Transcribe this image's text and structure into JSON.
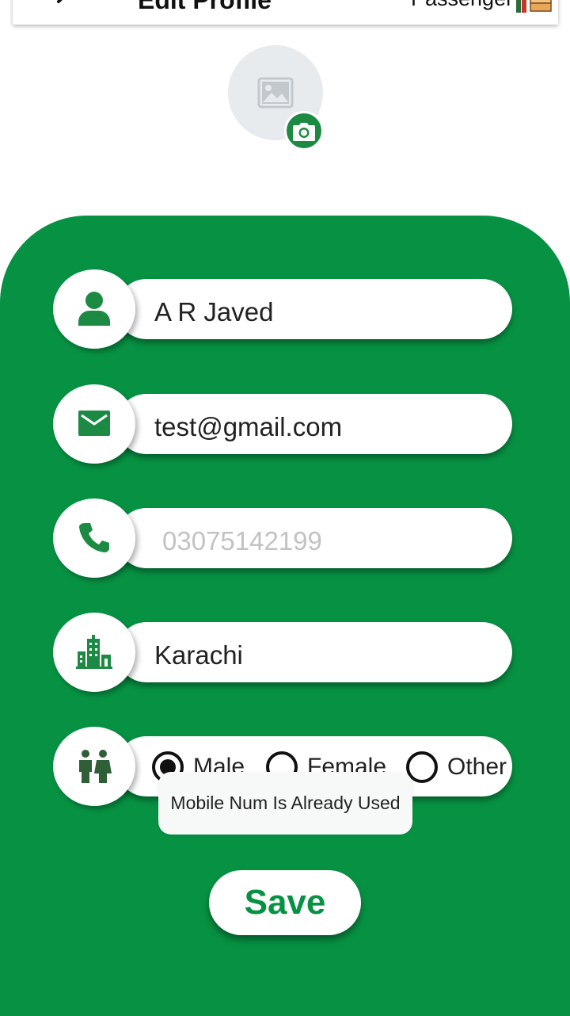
{
  "header": {
    "title": "Edit Profile",
    "role_label": "Passenger",
    "back_icon": "back-arrow-icon",
    "role_icon": "passenger-icon"
  },
  "avatar": {
    "placeholder_icon": "image-placeholder-icon",
    "camera_icon": "camera-icon"
  },
  "form": {
    "name": {
      "value": "A R Javed",
      "icon": "person-icon"
    },
    "email": {
      "value": "test@gmail.com",
      "icon": "mail-icon"
    },
    "phone": {
      "placeholder": "03075142199",
      "icon": "phone-icon"
    },
    "city": {
      "value": "Karachi",
      "icon": "city-icon"
    },
    "gender": {
      "icon": "gender-icon",
      "options": [
        "Male",
        "Female",
        "Other"
      ],
      "selected": "Male"
    }
  },
  "toast": {
    "message": "Mobile Num Is Already Used"
  },
  "save_label": "Save",
  "colors": {
    "primary_green": "#079243",
    "icon_green": "#1d8a44",
    "gender_icon_green": "#2f5f36",
    "avatar_bg": "#e8ebee"
  }
}
